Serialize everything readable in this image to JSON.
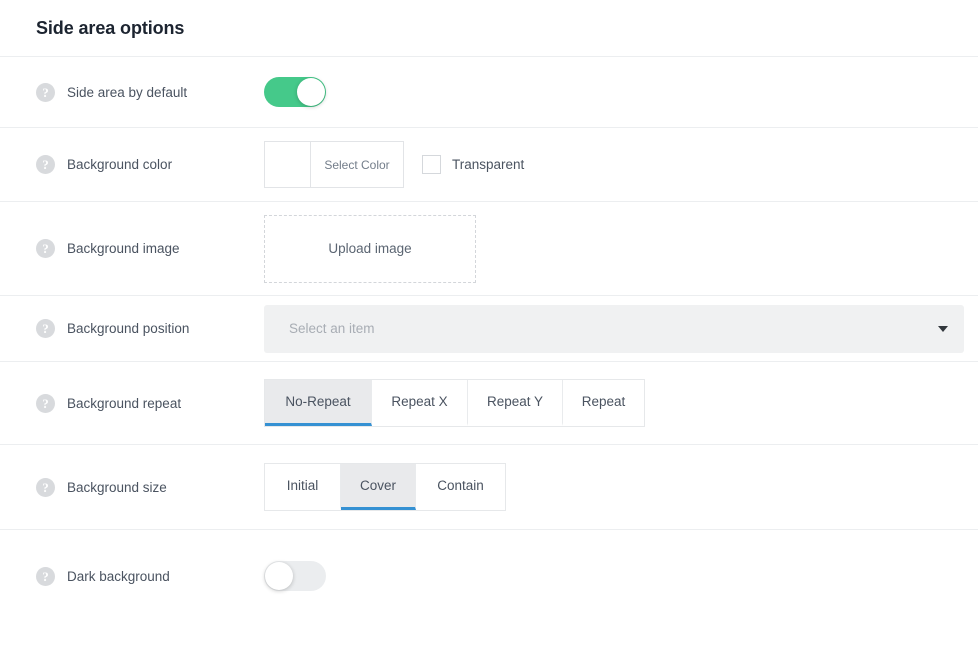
{
  "header": {
    "title": "Side area options"
  },
  "icons": {
    "help": "?",
    "help_icon_name": "help-icon",
    "chevron": "chevron-down-icon"
  },
  "colors": {
    "toggle_on": "#45c98a",
    "toggle_off": "#ebedef",
    "tab_active_underline": "#3591d3",
    "tab_active_background": "#e9eaec",
    "label_text": "#4a5360",
    "title_text": "#1c2430",
    "divider": "#eceef0",
    "select_background": "#f0f1f2"
  },
  "rows": {
    "side_area_default": {
      "label": "Side area by default",
      "toggle_state": "on"
    },
    "background_color": {
      "label": "Background color",
      "select_color_label": "Select Color",
      "swatch_value": "",
      "transparent_label": "Transparent",
      "transparent_checked": false
    },
    "background_image": {
      "label": "Background image",
      "upload_label": "Upload image"
    },
    "background_position": {
      "label": "Background position",
      "placeholder": "Select an item",
      "value": ""
    },
    "background_repeat": {
      "label": "Background repeat",
      "tabs": [
        {
          "label": "No-Repeat",
          "active": true
        },
        {
          "label": "Repeat X",
          "active": false
        },
        {
          "label": "Repeat Y",
          "active": false
        },
        {
          "label": "Repeat",
          "active": false
        }
      ]
    },
    "background_size": {
      "label": "Background size",
      "tabs": [
        {
          "label": "Initial",
          "active": false
        },
        {
          "label": "Cover",
          "active": true
        },
        {
          "label": "Contain",
          "active": false
        }
      ]
    },
    "dark_background": {
      "label": "Dark background",
      "toggle_state": "off"
    }
  }
}
